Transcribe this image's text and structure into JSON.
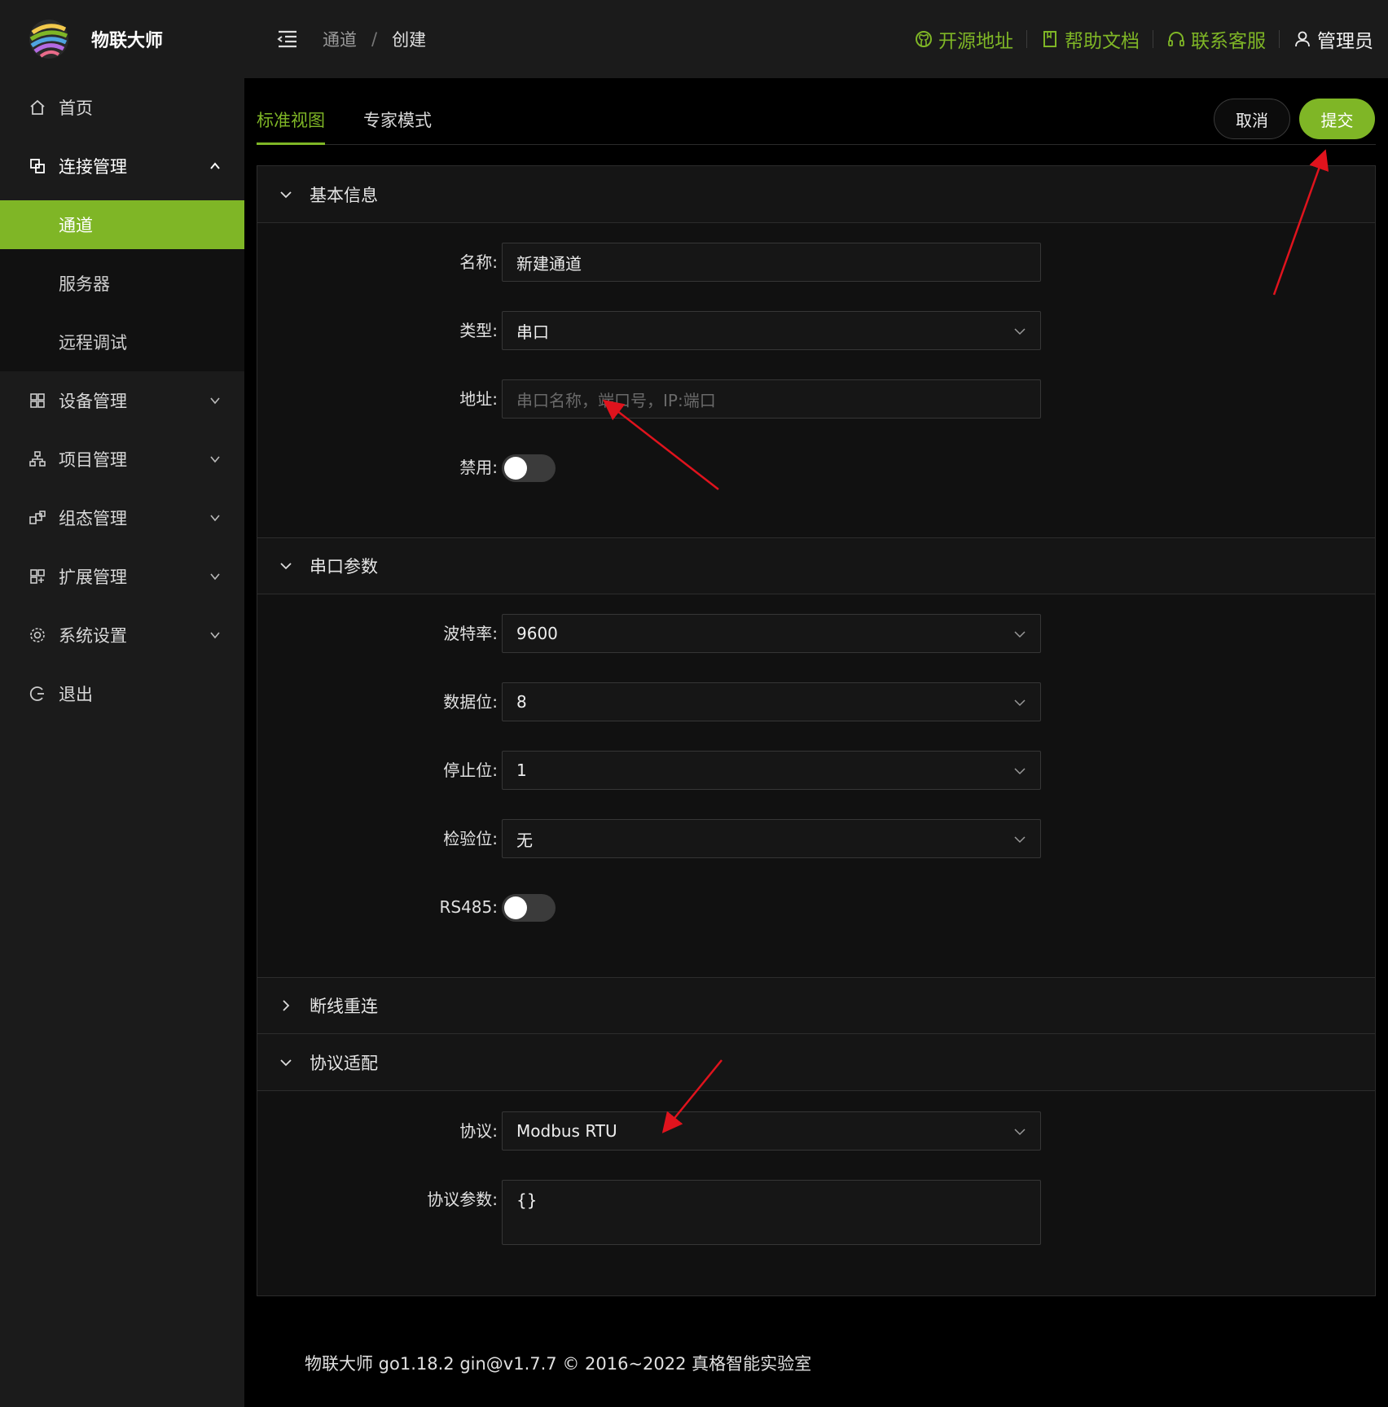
{
  "app": {
    "name": "物联大师"
  },
  "sidebar": {
    "items": [
      {
        "label": "首页",
        "icon": "home-icon"
      },
      {
        "label": "连接管理",
        "icon": "link-icon",
        "expanded": true
      },
      {
        "label": "设备管理",
        "icon": "grid-icon"
      },
      {
        "label": "项目管理",
        "icon": "sitemap-icon"
      },
      {
        "label": "组态管理",
        "icon": "blocks-icon"
      },
      {
        "label": "扩展管理",
        "icon": "apps-icon"
      },
      {
        "label": "系统设置",
        "icon": "gear-icon"
      },
      {
        "label": "退出",
        "icon": "logout-icon"
      }
    ],
    "submenu": [
      {
        "label": "通道",
        "active": true
      },
      {
        "label": "服务器"
      },
      {
        "label": "远程调试"
      }
    ]
  },
  "header": {
    "breadcrumb": [
      "通道",
      "创建"
    ],
    "breadcrumb_sep": "/",
    "links": {
      "source": "开源地址",
      "docs": "帮助文档",
      "support": "联系客服"
    },
    "user": "管理员"
  },
  "tabs": [
    "标准视图",
    "专家模式"
  ],
  "actions": {
    "cancel": "取消",
    "submit": "提交"
  },
  "sections": {
    "basic": {
      "title": "基本信息",
      "name_label": "名称:",
      "name_value": "新建通道",
      "type_label": "类型:",
      "type_value": "串口",
      "addr_label": "地址:",
      "addr_placeholder": "串口名称，端口号，IP:端口",
      "disabled_label": "禁用:",
      "disabled_on": false
    },
    "serial": {
      "title": "串口参数",
      "baud_label": "波特率:",
      "baud_value": "9600",
      "databits_label": "数据位:",
      "databits_value": "8",
      "stopbits_label": "停止位:",
      "stopbits_value": "1",
      "parity_label": "检验位:",
      "parity_value": "无",
      "rs485_label": "RS485:",
      "rs485_on": false
    },
    "reconnect": {
      "title": "断线重连"
    },
    "protocol": {
      "title": "协议适配",
      "protocol_label": "协议:",
      "protocol_value": "Modbus RTU",
      "params_label": "协议参数:",
      "params_value": "{}"
    }
  },
  "footer": "物联大师 go1.18.2 gin@v1.7.7 © 2016~2022 真格智能实验室",
  "colors": {
    "accent": "#7fb626",
    "annotation": "#e0131d"
  }
}
